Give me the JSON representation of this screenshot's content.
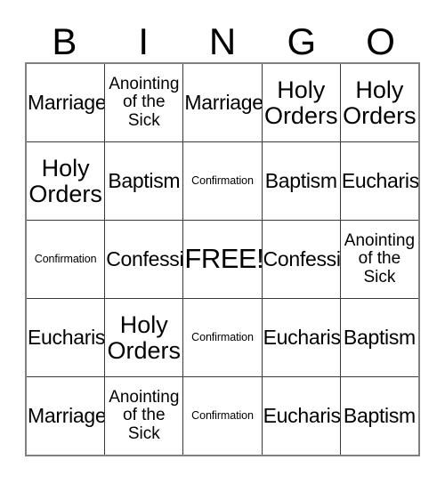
{
  "card": {
    "header_letters": [
      "B",
      "I",
      "N",
      "G",
      "O"
    ],
    "rows": [
      [
        {
          "label": "Marriage",
          "size": "lg"
        },
        {
          "label": "Anointing of the Sick",
          "size": "md"
        },
        {
          "label": "Marriage",
          "size": "lg"
        },
        {
          "label": "Holy Orders",
          "size": "xl"
        },
        {
          "label": "Holy Orders",
          "size": "xl"
        }
      ],
      [
        {
          "label": "Holy Orders",
          "size": "xl"
        },
        {
          "label": "Baptism",
          "size": "lg"
        },
        {
          "label": "Confirmation",
          "size": "sm"
        },
        {
          "label": "Baptism",
          "size": "lg"
        },
        {
          "label": "Eucharist",
          "size": "lg"
        }
      ],
      [
        {
          "label": "Confirmation",
          "size": "sm"
        },
        {
          "label": "Confession",
          "size": "lg"
        },
        {
          "label": "FREE!",
          "size": "free"
        },
        {
          "label": "Confession",
          "size": "lg"
        },
        {
          "label": "Anointing of the Sick",
          "size": "md"
        }
      ],
      [
        {
          "label": "Eucharist",
          "size": "lg"
        },
        {
          "label": "Holy Orders",
          "size": "xl"
        },
        {
          "label": "Confirmation",
          "size": "sm"
        },
        {
          "label": "Eucharist",
          "size": "lg"
        },
        {
          "label": "Baptism",
          "size": "lg"
        }
      ],
      [
        {
          "label": "Marriage",
          "size": "lg"
        },
        {
          "label": "Anointing of the Sick",
          "size": "md"
        },
        {
          "label": "Confirmation",
          "size": "sm"
        },
        {
          "label": "Eucharist",
          "size": "lg"
        },
        {
          "label": "Baptism",
          "size": "lg"
        }
      ]
    ],
    "free_space": {
      "row": 2,
      "col": 2,
      "label": "FREE!"
    },
    "colors": {
      "background": "#ffffff",
      "text": "#000000",
      "grid_line": "#3a3a3a",
      "outer_border": "#808080"
    }
  }
}
